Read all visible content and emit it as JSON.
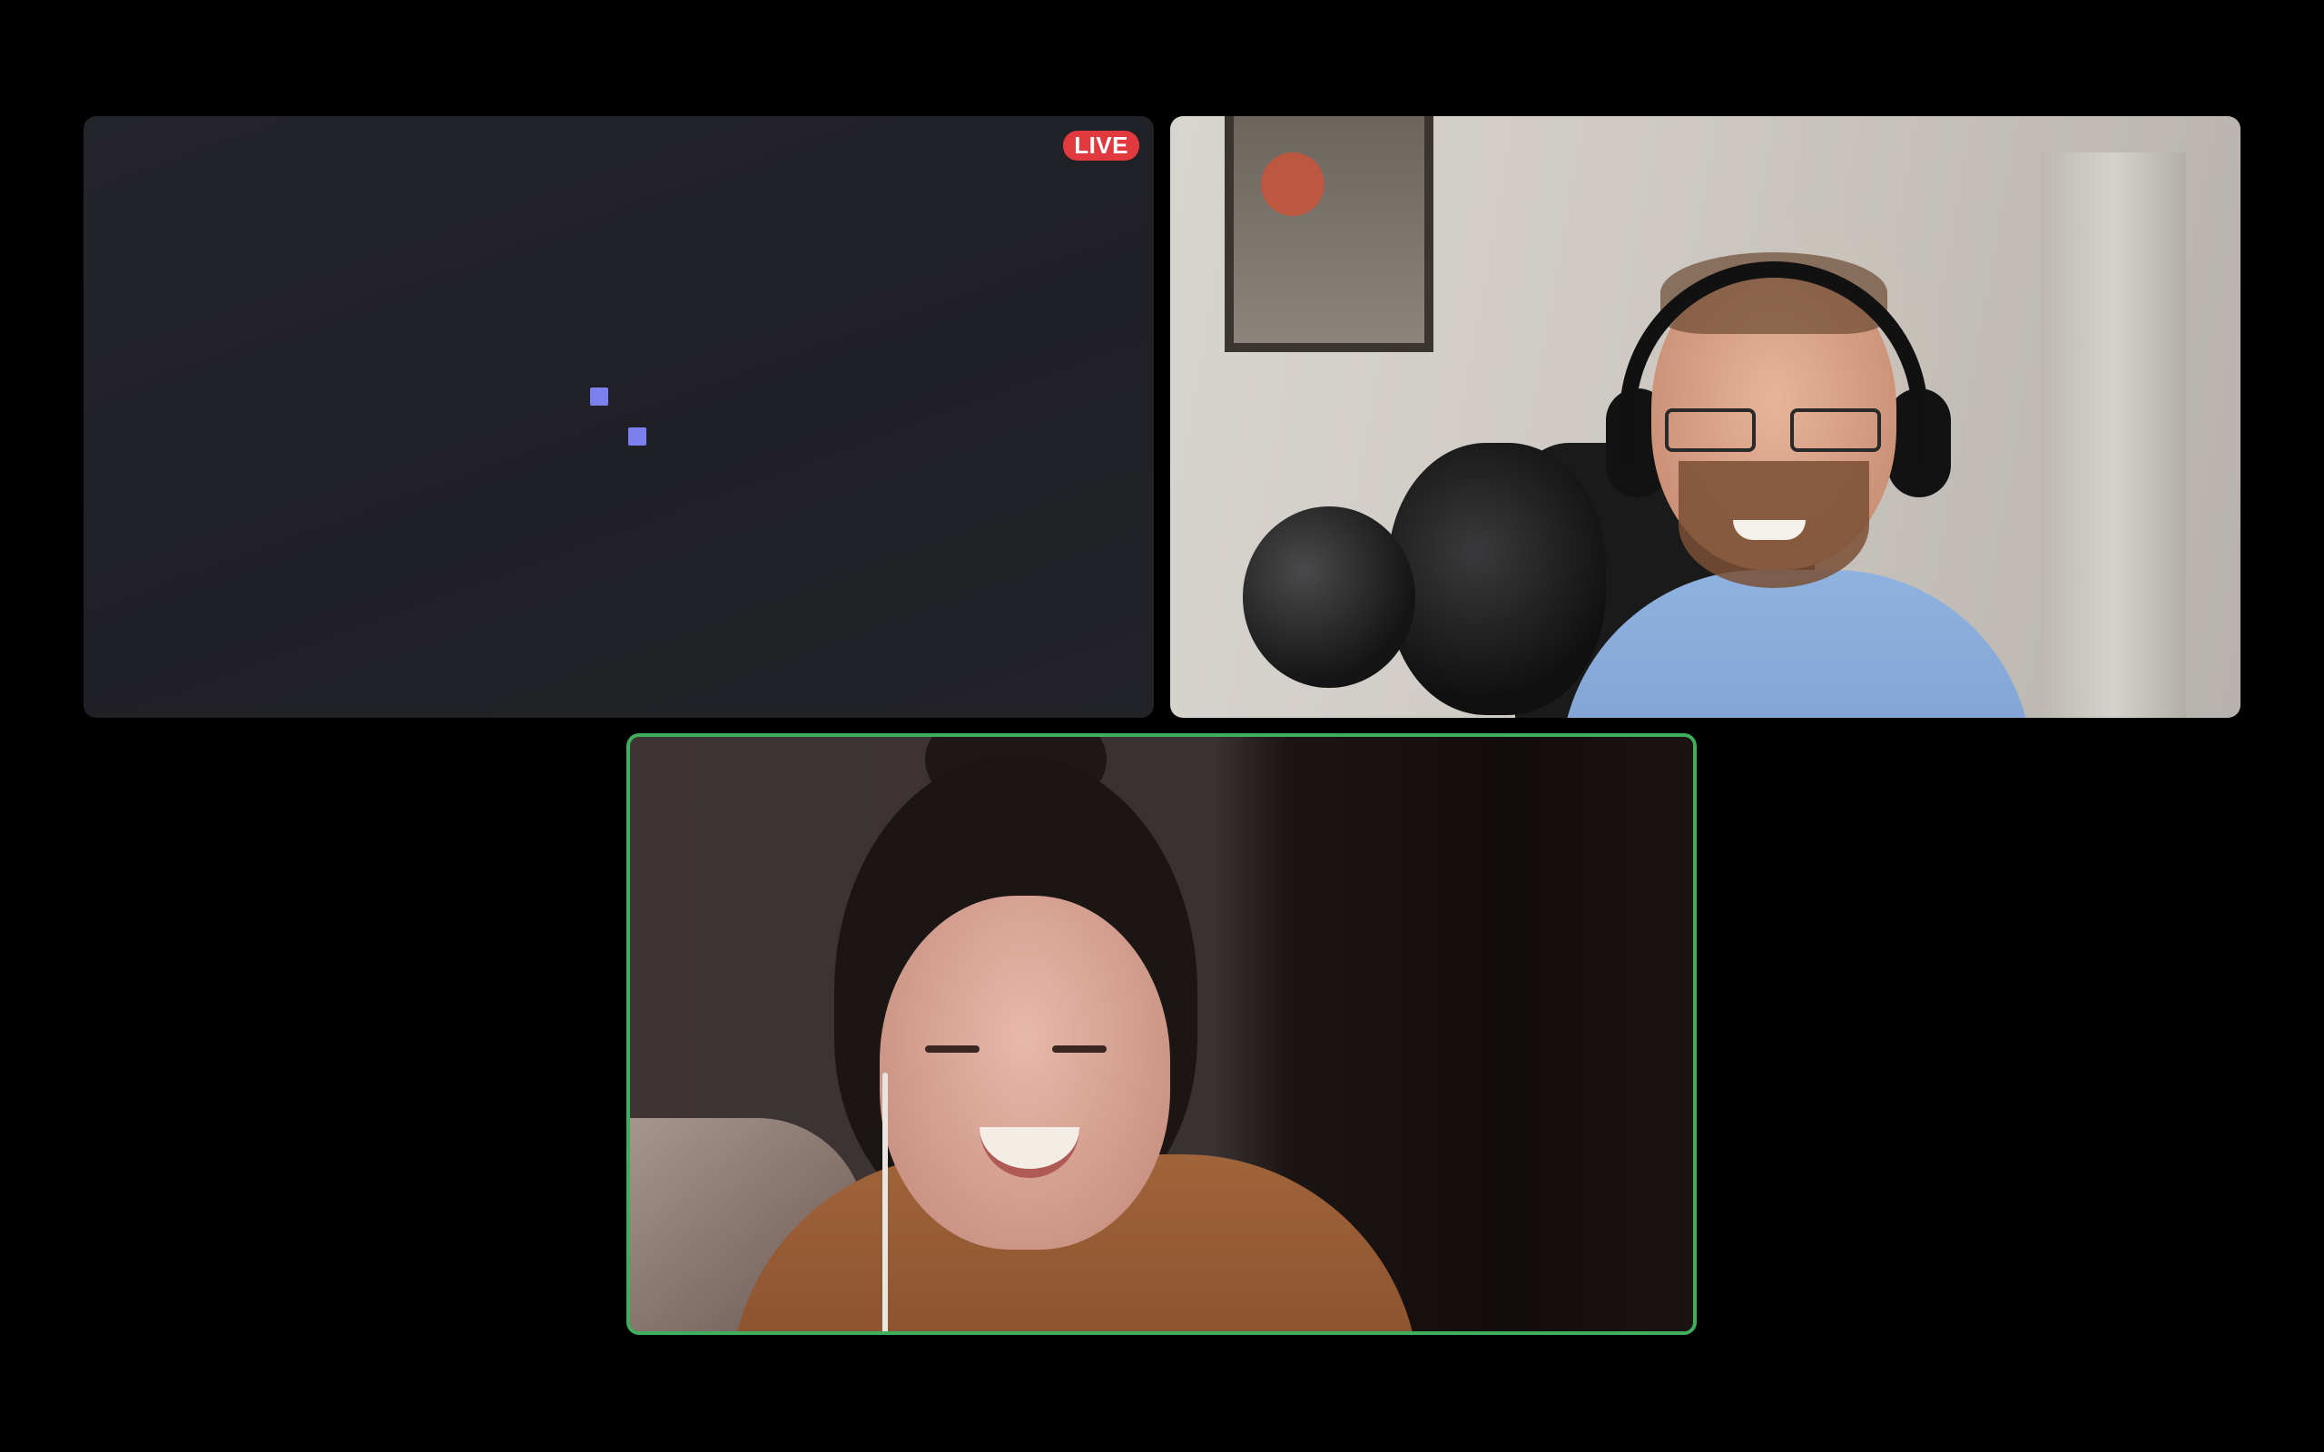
{
  "layout": {
    "tiles": [
      {
        "id": "screen-share-placeholder",
        "state": "loading",
        "badge": "LIVE"
      },
      {
        "id": "participant-1",
        "state": "video"
      },
      {
        "id": "participant-2",
        "state": "video",
        "active_speaker": true
      }
    ]
  },
  "colors": {
    "background": "#000000",
    "tile_placeholder": "#222328",
    "live_badge": "#e0393e",
    "loader_dots": "#7b80ee",
    "active_speaker_border": "#3fae5d"
  },
  "icons": {
    "loader": "loading-dots-icon"
  }
}
